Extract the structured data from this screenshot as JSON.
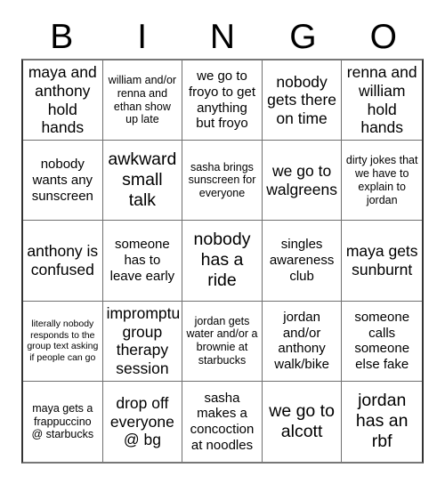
{
  "card": {
    "title_letters": [
      "B",
      "I",
      "N",
      "G",
      "O"
    ],
    "columns": 5,
    "rows": 5,
    "cells": [
      {
        "text": "maya and anthony hold hands",
        "size": "lg"
      },
      {
        "text": "william and/or renna and ethan show up late",
        "size": "sm"
      },
      {
        "text": "we go to froyo to get anything but froyo",
        "size": "md"
      },
      {
        "text": "nobody gets there on time",
        "size": "lg"
      },
      {
        "text": "renna and william hold hands",
        "size": "lg"
      },
      {
        "text": "nobody wants any sunscreen",
        "size": "md"
      },
      {
        "text": "awkward small talk",
        "size": "xl"
      },
      {
        "text": "sasha brings sunscreen for everyone",
        "size": "sm"
      },
      {
        "text": "we go to walgreens",
        "size": "lg"
      },
      {
        "text": "dirty jokes that we have to explain to jordan",
        "size": "sm"
      },
      {
        "text": "anthony is confused",
        "size": "lg"
      },
      {
        "text": "someone has to leave early",
        "size": "md"
      },
      {
        "text": "nobody has a ride",
        "size": "xl"
      },
      {
        "text": "singles awareness club",
        "size": "md"
      },
      {
        "text": "maya gets sunburnt",
        "size": "lg"
      },
      {
        "text": "literally nobody responds to the group text asking if people can go",
        "size": "xs"
      },
      {
        "text": "impromptu group therapy session",
        "size": "lg"
      },
      {
        "text": "jordan gets water and/or a brownie at starbucks",
        "size": "sm"
      },
      {
        "text": "jordan and/or anthony walk/bike",
        "size": "md"
      },
      {
        "text": "someone calls someone else fake",
        "size": "md"
      },
      {
        "text": "maya gets a frappuccino @ starbucks",
        "size": "sm"
      },
      {
        "text": "drop off everyone @ bg",
        "size": "lg"
      },
      {
        "text": "sasha makes a concoction at noodles",
        "size": "md"
      },
      {
        "text": "we go to alcott",
        "size": "xl"
      },
      {
        "text": "jordan has an rbf",
        "size": "xl"
      }
    ]
  },
  "colors": {
    "background": "#ffffff",
    "text": "#000000",
    "grid_line": "#6f6f6f",
    "grid_outer": "#333333"
  }
}
